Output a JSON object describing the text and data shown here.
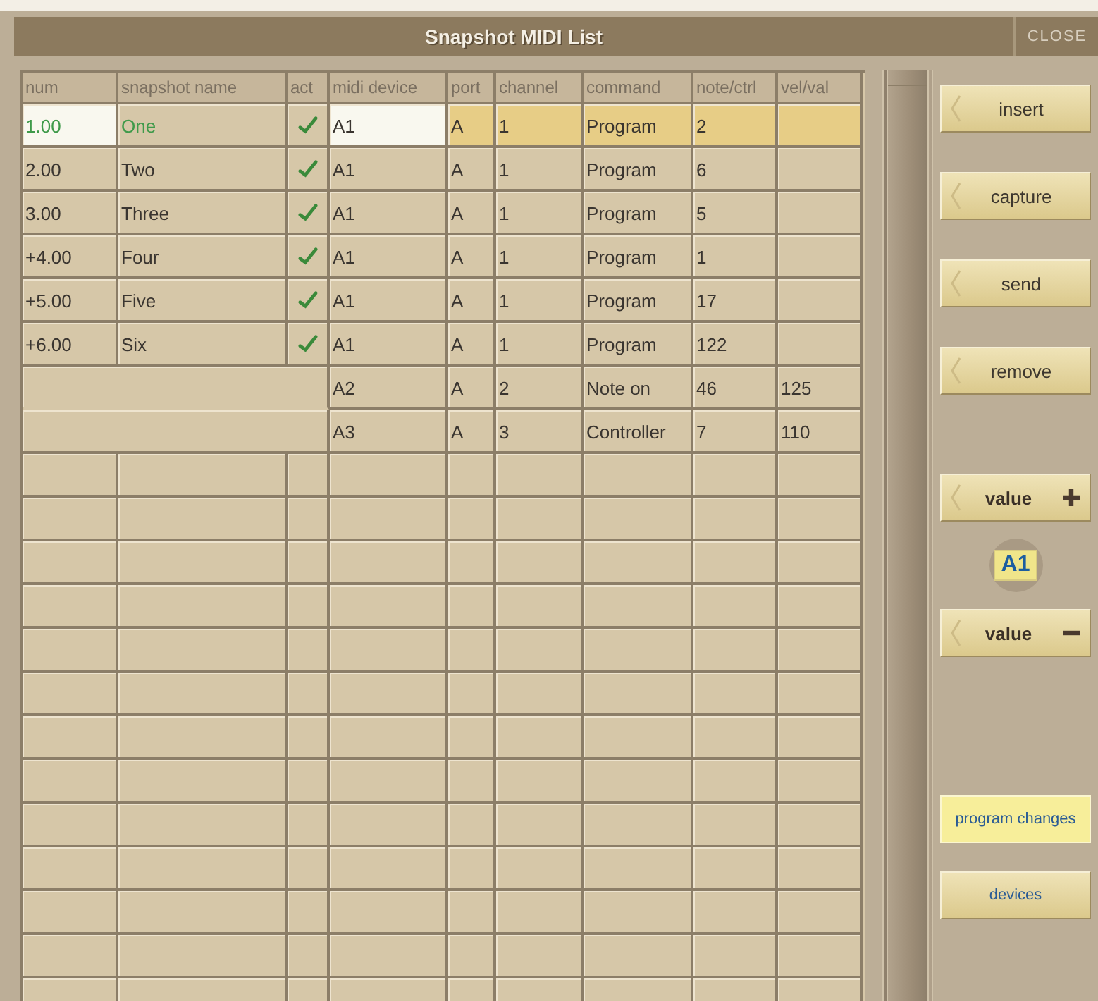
{
  "window": {
    "title": "Snapshot MIDI List",
    "close_label": "CLOSE"
  },
  "table": {
    "columns": [
      "num",
      "snapshot name",
      "act",
      "midi device",
      "port",
      "channel",
      "command",
      "note/ctrl",
      "vel/val"
    ],
    "rows": [
      {
        "kind": "snapshot",
        "selected": true,
        "num": "1.00",
        "name": "One",
        "active": true,
        "device": "A1",
        "port": "A",
        "channel": "1",
        "command": "Program",
        "note": "2"
      },
      {
        "kind": "snapshot",
        "selected": false,
        "num": "2.00",
        "name": "Two",
        "active": true,
        "device": "A1",
        "port": "A",
        "channel": "1",
        "command": "Program",
        "note": "6"
      },
      {
        "kind": "snapshot",
        "selected": false,
        "num": "3.00",
        "name": "Three",
        "active": true,
        "device": "A1",
        "port": "A",
        "channel": "1",
        "command": "Program",
        "note": "5"
      },
      {
        "kind": "snapshot",
        "selected": false,
        "num": "+4.00",
        "name": "Four",
        "active": true,
        "device": "A1",
        "port": "A",
        "channel": "1",
        "command": "Program",
        "note": "1"
      },
      {
        "kind": "snapshot",
        "selected": false,
        "num": "+5.00",
        "name": "Five",
        "active": true,
        "device": "A1",
        "port": "A",
        "channel": "1",
        "command": "Program",
        "note": "17"
      },
      {
        "kind": "snapshot",
        "selected": false,
        "num": "+6.00",
        "name": "Six",
        "active": true,
        "device": "A1",
        "port": "A",
        "channel": "1",
        "command": "Program",
        "note": "122"
      },
      {
        "kind": "continuation",
        "selected": false,
        "device": "A2",
        "port": "A",
        "channel": "2",
        "command": "Note on",
        "note": "46",
        "vel": "125"
      },
      {
        "kind": "continuation",
        "selected": false,
        "device": "A3",
        "port": "A",
        "channel": "3",
        "command": "Controller",
        "note": "7",
        "vel": "110"
      }
    ]
  },
  "side_buttons": [
    {
      "label": "insert"
    },
    {
      "label": "capture"
    },
    {
      "label": "send"
    },
    {
      "label": "remove"
    }
  ],
  "value_control": {
    "up_label": "value",
    "display": "A1",
    "down_label": "value"
  },
  "mode_buttons": [
    {
      "label": "program changes",
      "selected": true
    },
    {
      "label": "devices",
      "selected": false
    }
  ]
}
